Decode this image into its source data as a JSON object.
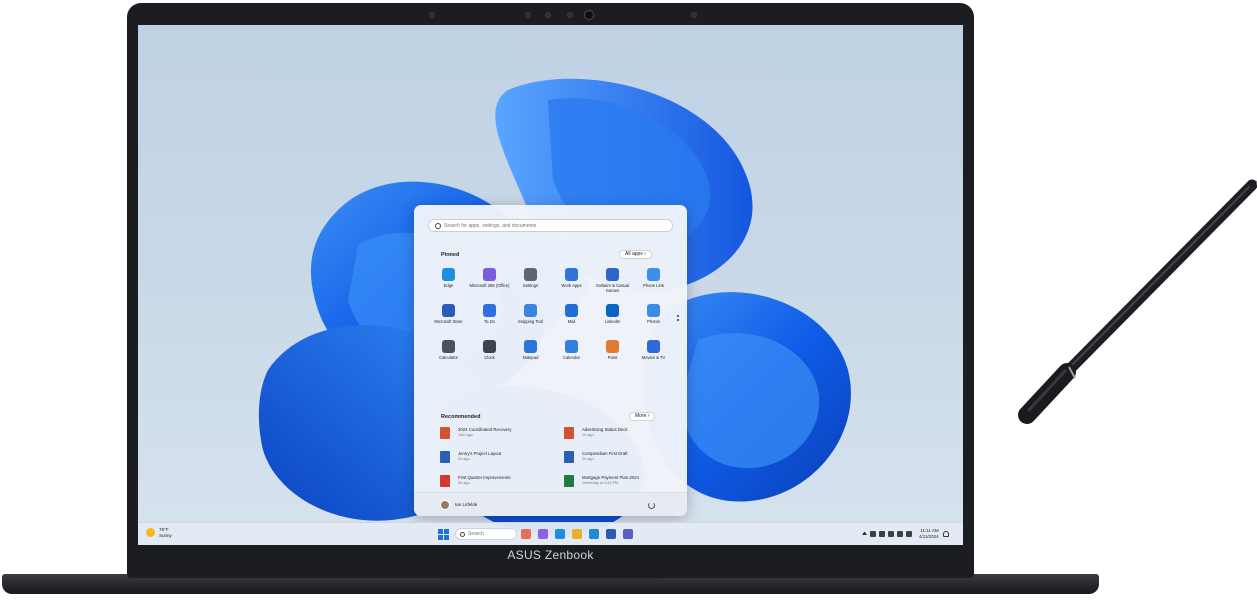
{
  "brand": {
    "name": "ASUS Zenbook"
  },
  "start_menu": {
    "search_placeholder": "Search for apps, settings, and documents",
    "pinned_label": "Pinned",
    "all_apps_label": "All apps  ›",
    "pinned": [
      {
        "label": "Edge",
        "icon": "edge-icon",
        "color": "#1d8fe0"
      },
      {
        "label": "Microsoft 365 (Office)",
        "icon": "office-icon",
        "color": "#7b5ce0"
      },
      {
        "label": "Settings",
        "icon": "gear-icon",
        "color": "#5d6570"
      },
      {
        "label": "Work Apps",
        "icon": "apps-folder-icon",
        "color": "#2f74d8"
      },
      {
        "label": "Solitaire & Casual Games",
        "icon": "cards-icon",
        "color": "#2a67c9"
      },
      {
        "label": "Phone Link",
        "icon": "phone-icon",
        "color": "#3a8fe6"
      },
      {
        "label": "Microsoft Store",
        "icon": "store-icon",
        "color": "#2c5bb8"
      },
      {
        "label": "To Do",
        "icon": "checkmark-icon",
        "color": "#2f6fe0"
      },
      {
        "label": "Snipping Tool",
        "icon": "scissors-icon",
        "color": "#3b83e3"
      },
      {
        "label": "Mail",
        "icon": "mail-icon",
        "color": "#1f6fd6"
      },
      {
        "label": "LinkedIn",
        "icon": "linkedin-icon",
        "color": "#0a66c2"
      },
      {
        "label": "Photos",
        "icon": "photos-icon",
        "color": "#3d8be8"
      },
      {
        "label": "Calculator",
        "icon": "calculator-icon",
        "color": "#4a525c"
      },
      {
        "label": "Clock",
        "icon": "clock-icon",
        "color": "#3c4450"
      },
      {
        "label": "Notepad",
        "icon": "notepad-icon",
        "color": "#2d74da"
      },
      {
        "label": "Calendar",
        "icon": "calendar-icon",
        "color": "#2f80e0"
      },
      {
        "label": "Paint",
        "icon": "paint-icon",
        "color": "#e07a2f"
      },
      {
        "label": "Movies & TV",
        "icon": "film-icon",
        "color": "#2f6ad8"
      }
    ],
    "recommended_label": "Recommended",
    "more_label": "More  ›",
    "recommended": [
      {
        "title": "2024 Coordinated Recovery",
        "sub": "10m ago",
        "icon": "powerpoint-file-icon",
        "color": "#d35230"
      },
      {
        "title": "Advertising Status Deck",
        "sub": "1h ago",
        "icon": "powerpoint-file-icon",
        "color": "#d35230"
      },
      {
        "title": "Jenny's Project Layout",
        "sub": "2h ago",
        "icon": "word-file-icon",
        "color": "#2b5fb4"
      },
      {
        "title": "Compendium First Draft",
        "sub": "2h ago",
        "icon": "word-file-icon",
        "color": "#2b5fb4"
      },
      {
        "title": "First Quarter Improvements",
        "sub": "6h ago",
        "icon": "pdf-file-icon",
        "color": "#d03a2e"
      },
      {
        "title": "Mortgage Payment Plan 2024",
        "sub": "Yesterday at 4:24 PM",
        "icon": "excel-file-icon",
        "color": "#1f7a44"
      }
    ],
    "user_name": "Ian Lirfelde"
  },
  "taskbar": {
    "weather_temp": "78°F",
    "weather_cond": "Sunny",
    "search_placeholder": "Search",
    "apps": [
      {
        "icon": "widgets-icon",
        "color": "#e86c5a"
      },
      {
        "icon": "copilot-icon",
        "color": "#8a63e6"
      },
      {
        "icon": "edge-icon",
        "color": "#1d8fe0"
      },
      {
        "icon": "file-explorer-icon",
        "color": "#e6b326"
      },
      {
        "icon": "browser-icon",
        "color": "#1f8ad8"
      },
      {
        "icon": "store-icon",
        "color": "#2c5bb8"
      },
      {
        "icon": "teams-icon",
        "color": "#5b5fc7"
      }
    ],
    "time": "11:11 AM",
    "date": "4/11/2024"
  }
}
